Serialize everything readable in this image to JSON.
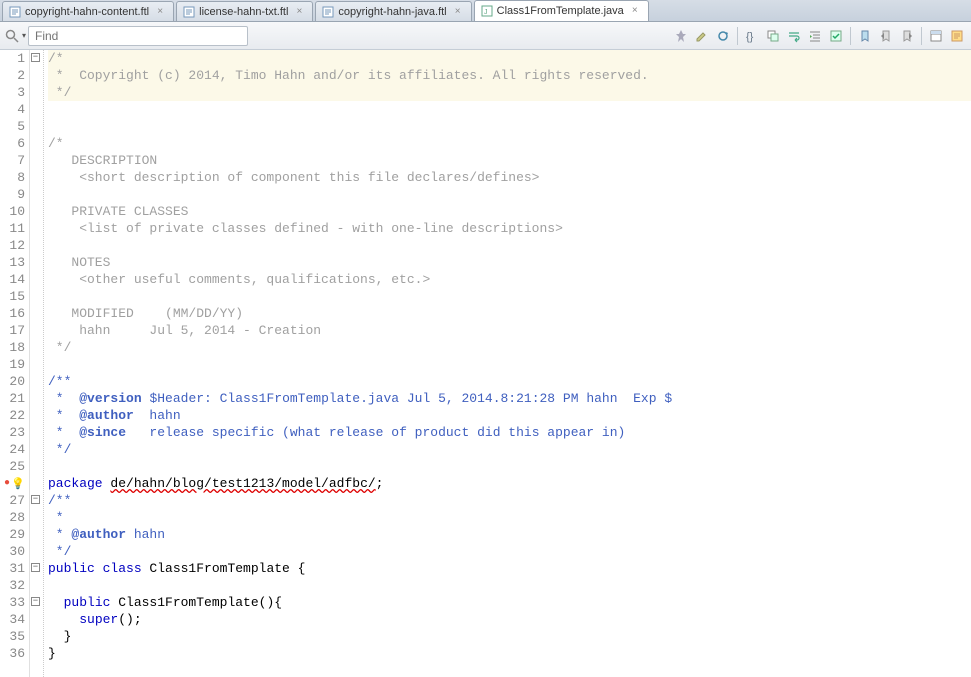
{
  "tabs": [
    {
      "label": "copyright-hahn-content.ftl",
      "icon": "ftl",
      "active": false
    },
    {
      "label": "license-hahn-txt.ftl",
      "icon": "ftl",
      "active": false
    },
    {
      "label": "copyright-hahn-java.ftl",
      "icon": "ftl",
      "active": false
    },
    {
      "label": "Class1FromTemplate.java",
      "icon": "java",
      "active": true
    }
  ],
  "find": {
    "placeholder": "Find"
  },
  "toolbar_icons": [
    "pin",
    "highlight",
    "refresh",
    "sep",
    "braces",
    "copy-block",
    "wrap",
    "indent",
    "check",
    "sep",
    "bookmark",
    "prev-bm",
    "next-bm",
    "sep",
    "layout",
    "page"
  ],
  "code": {
    "lines": [
      {
        "n": 1,
        "hl": true,
        "fold": "minus",
        "segs": [
          {
            "t": "/*",
            "c": "comment"
          }
        ]
      },
      {
        "n": 2,
        "hl": true,
        "segs": [
          {
            "t": " *  Copyright (c) 2014, Timo Hahn and/or its affiliates. All rights reserved.",
            "c": "comment"
          }
        ]
      },
      {
        "n": 3,
        "hl": true,
        "segs": [
          {
            "t": " */",
            "c": "comment"
          }
        ]
      },
      {
        "n": 4,
        "segs": []
      },
      {
        "n": 5,
        "segs": []
      },
      {
        "n": 6,
        "segs": [
          {
            "t": "/*",
            "c": "comment"
          }
        ]
      },
      {
        "n": 7,
        "segs": [
          {
            "t": "   DESCRIPTION",
            "c": "comment"
          }
        ]
      },
      {
        "n": 8,
        "segs": [
          {
            "t": "    <short description of component this file declares/defines>",
            "c": "comment"
          }
        ]
      },
      {
        "n": 9,
        "segs": []
      },
      {
        "n": 10,
        "segs": [
          {
            "t": "   PRIVATE CLASSES",
            "c": "comment"
          }
        ]
      },
      {
        "n": 11,
        "segs": [
          {
            "t": "    <list of private classes defined - with one-line descriptions>",
            "c": "comment"
          }
        ]
      },
      {
        "n": 12,
        "segs": []
      },
      {
        "n": 13,
        "segs": [
          {
            "t": "   NOTES",
            "c": "comment"
          }
        ]
      },
      {
        "n": 14,
        "segs": [
          {
            "t": "    <other useful comments, qualifications, etc.>",
            "c": "comment"
          }
        ]
      },
      {
        "n": 15,
        "segs": []
      },
      {
        "n": 16,
        "segs": [
          {
            "t": "   MODIFIED    (MM/DD/YY)",
            "c": "comment"
          }
        ]
      },
      {
        "n": 17,
        "segs": [
          {
            "t": "    hahn     Jul 5, 2014 - Creation",
            "c": "comment"
          }
        ]
      },
      {
        "n": 18,
        "segs": [
          {
            "t": " */",
            "c": "comment"
          }
        ]
      },
      {
        "n": 19,
        "segs": []
      },
      {
        "n": 20,
        "segs": [
          {
            "t": "/**",
            "c": "doc"
          }
        ]
      },
      {
        "n": 21,
        "segs": [
          {
            "t": " *  ",
            "c": "doc"
          },
          {
            "t": "@version",
            "c": "doctag"
          },
          {
            "t": " $Header: Class1FromTemplate.java Jul 5, 2014.8:21:28 PM hahn  Exp $",
            "c": "doc"
          }
        ]
      },
      {
        "n": 22,
        "segs": [
          {
            "t": " *  ",
            "c": "doc"
          },
          {
            "t": "@author",
            "c": "doctag"
          },
          {
            "t": "  hahn",
            "c": "doc"
          }
        ]
      },
      {
        "n": 23,
        "segs": [
          {
            "t": " *  ",
            "c": "doc"
          },
          {
            "t": "@since",
            "c": "doctag"
          },
          {
            "t": "   release specific (what release of product did this appear in)",
            "c": "doc"
          }
        ]
      },
      {
        "n": 24,
        "segs": [
          {
            "t": " */",
            "c": "doc"
          }
        ]
      },
      {
        "n": 25,
        "segs": []
      },
      {
        "n": 26,
        "err": true,
        "segs": [
          {
            "t": "package",
            "c": "kw"
          },
          {
            "t": " ",
            "c": "plain"
          },
          {
            "t": "de/hahn/blog/test1213/model/adfbc/",
            "c": "err"
          },
          {
            "t": ";",
            "c": "plain"
          }
        ]
      },
      {
        "n": 27,
        "fold": "minus",
        "segs": [
          {
            "t": "/**",
            "c": "doc"
          }
        ]
      },
      {
        "n": 28,
        "segs": [
          {
            "t": " *",
            "c": "doc"
          }
        ]
      },
      {
        "n": 29,
        "segs": [
          {
            "t": " * ",
            "c": "doc"
          },
          {
            "t": "@author",
            "c": "doctag"
          },
          {
            "t": " hahn",
            "c": "doc"
          }
        ]
      },
      {
        "n": 30,
        "segs": [
          {
            "t": " */",
            "c": "doc"
          }
        ]
      },
      {
        "n": 31,
        "fold": "minus",
        "segs": [
          {
            "t": "public class",
            "c": "kw"
          },
          {
            "t": " Class1FromTemplate {",
            "c": "plain"
          }
        ]
      },
      {
        "n": 32,
        "segs": []
      },
      {
        "n": 33,
        "fold": "minus",
        "segs": [
          {
            "t": "  ",
            "c": "plain"
          },
          {
            "t": "public",
            "c": "kw"
          },
          {
            "t": " Class1FromTemplate(){",
            "c": "plain"
          }
        ]
      },
      {
        "n": 34,
        "segs": [
          {
            "t": "    ",
            "c": "plain"
          },
          {
            "t": "super",
            "c": "kw"
          },
          {
            "t": "();",
            "c": "plain"
          }
        ]
      },
      {
        "n": 35,
        "segs": [
          {
            "t": "  }",
            "c": "plain"
          }
        ]
      },
      {
        "n": 36,
        "segs": [
          {
            "t": "}",
            "c": "plain"
          }
        ]
      }
    ]
  }
}
